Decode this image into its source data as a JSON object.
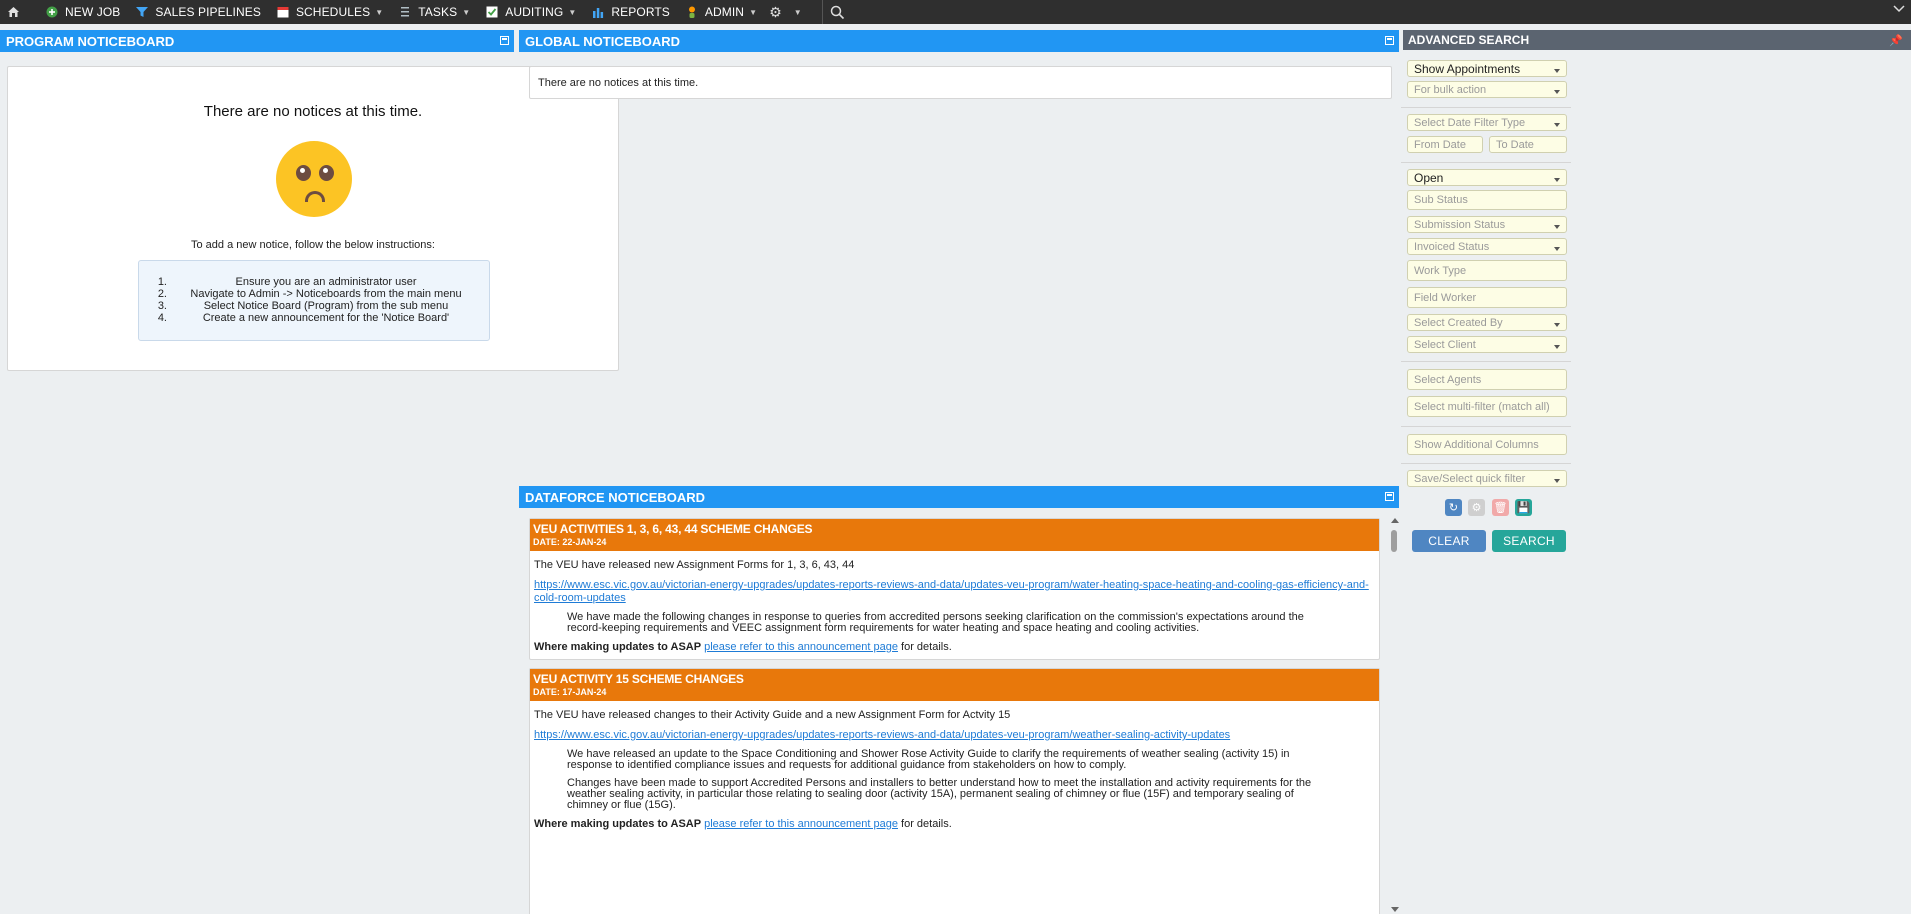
{
  "nav": {
    "items": [
      {
        "label": "NEW JOB",
        "icon": "plus-circle-icon",
        "caret": false
      },
      {
        "label": "SALES PIPELINES",
        "icon": "funnel-icon",
        "caret": false
      },
      {
        "label": "SCHEDULES",
        "icon": "calendar-icon",
        "caret": true
      },
      {
        "label": "TASKS",
        "icon": "list-icon",
        "caret": true
      },
      {
        "label": "AUDITING",
        "icon": "checkbox-icon",
        "caret": true
      },
      {
        "label": "REPORTS",
        "icon": "bar-chart-icon",
        "caret": false
      },
      {
        "label": "ADMIN",
        "icon": "person-icon",
        "caret": true
      }
    ]
  },
  "program": {
    "title": "PROGRAM NOTICEBOARD",
    "empty": "There are no notices at this time.",
    "instructions_intro": "To add a new notice, follow the below instructions:",
    "steps": [
      {
        "num": "1.",
        "text": "Ensure you are an administrator user"
      },
      {
        "num": "2.",
        "text": "Navigate to Admin -> Noticeboards from the main menu"
      },
      {
        "num": "3.",
        "text": "Select Notice Board (Program) from the sub menu"
      },
      {
        "num": "4.",
        "text": "Create a new announcement for the 'Notice Board'"
      }
    ]
  },
  "global": {
    "title": "GLOBAL NOTICEBOARD",
    "empty": "There are no notices at this time."
  },
  "dataforce": {
    "title": "DATAFORCE NOTICEBOARD",
    "notices": [
      {
        "title": "VEU ACTIVITIES 1, 3, 6, 43, 44 SCHEME CHANGES",
        "date": "DATE: 22-JAN-24",
        "intro": "The VEU have released new Assignment Forms for 1, 3, 6, 43, 44",
        "link": "https://www.esc.vic.gov.au/victorian-energy-upgrades/updates-reports-reviews-and-data/updates-veu-program/water-heating-space-heating-and-cooling-gas-efficiency-and-cold-room-updates",
        "paragraphs": [
          "We have made the following changes in response to queries from accredited persons seeking clarification on the commission's expectations around the record-keeping requirements and VEEC assignment form requirements for water heating and space heating and cooling activities."
        ],
        "asap_label": "Where making updates to ASAP",
        "asap_link": "please refer to this announcement page",
        "asap_tail": " for details."
      },
      {
        "title": "VEU ACTIVITY 15 SCHEME CHANGES",
        "date": "DATE: 17-JAN-24",
        "intro": "The VEU have released changes to their Activity Guide and a new Assignment Form for Actvity 15",
        "link": "https://www.esc.vic.gov.au/victorian-energy-upgrades/updates-reports-reviews-and-data/updates-veu-program/weather-sealing-activity-updates",
        "paragraphs": [
          "We have released an update to the Space Conditioning and Shower Rose Activity Guide to clarify the requirements of weather sealing (activity 15) in response to identified compliance issues and requests for additional guidance from stakeholders on how to comply.",
          "Changes have been made to support Accredited Persons and installers to better understand how to meet the installation and activity requirements for the weather sealing activity, in particular those relating to sealing door (activity 15A), permanent sealing of chimney or flue (15F) and temporary sealing of chimney or flue (15G)."
        ],
        "asap_label": "Where making updates to ASAP",
        "asap_link": "please refer to this announcement page",
        "asap_tail": " for details."
      }
    ]
  },
  "search": {
    "title": "ADVANCED SEARCH",
    "show": "Show Appointments",
    "bulk": "For bulk action",
    "date_filter": "Select Date Filter Type",
    "from_date": "From Date",
    "to_date": "To Date",
    "status": "Open",
    "sub_status": "Sub Status",
    "submission_status": "Submission Status",
    "invoiced_status": "Invoiced Status",
    "work_type": "Work Type",
    "field_worker": "Field Worker",
    "created_by": "Select Created By",
    "client": "Select Client",
    "agents": "Select Agents",
    "multi_filter": "Select multi-filter (match all)",
    "additional_columns": "Show Additional Columns",
    "quick_filter": "Save/Select quick filter",
    "clear": "CLEAR",
    "search": "SEARCH"
  },
  "colors": {
    "nav_bg": "#2f2f2f",
    "panel_header": "#2196f3",
    "notice_header": "#e8780b",
    "clear_btn": "#4f86c2",
    "search_btn": "#26a69a"
  }
}
